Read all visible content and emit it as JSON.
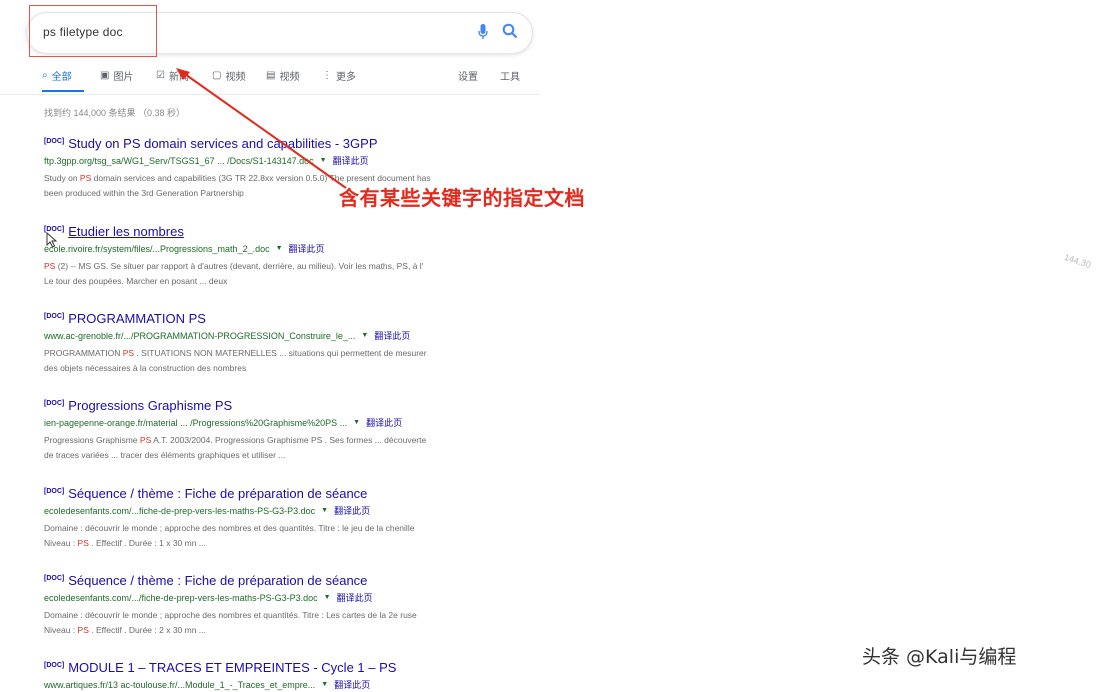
{
  "search": {
    "query": "ps filetype doc"
  },
  "tabs": [
    {
      "label": "全部",
      "icon": "search-icon",
      "active": true
    },
    {
      "label": "图片",
      "icon": "image-icon"
    },
    {
      "label": "新闻",
      "icon": "news-icon"
    },
    {
      "label": "视频",
      "icon": "video-icon"
    },
    {
      "label": "视频",
      "icon": "grid-icon"
    },
    {
      "label": "更多",
      "icon": "more-icon"
    }
  ],
  "tools": {
    "settings": "设置",
    "tools": "工具"
  },
  "result_stats": "找到约 144,000 条结果 （0.38 秒）",
  "results": [
    {
      "filetype": "[DOC]",
      "title": "Study on PS domain services and capabilities - 3GPP",
      "url": "ftp.3gpp.org/tsg_sa/WG1_Serv/TSGS1_67 ... /Docs/S1-143147.doc",
      "cached": "翻译此页",
      "snippet": [
        {
          "pre": "Study on ",
          "kw": "PS",
          "post": " domain services and capabilities (3G TR 22.8xx version 0.5.0) The present document has"
        },
        {
          "pre": "been produced within the 3rd Generation Partnership",
          "kw": "",
          "post": ""
        }
      ]
    },
    {
      "filetype": "[DOC]",
      "title": "Etudier les nombres",
      "url": "ecole.rivoire.fr/system/files/...Progressions_math_2_.doc",
      "cached": "翻译此页",
      "snippet": [
        {
          "pre": "",
          "kw": "PS",
          "post": " (2) -- MS GS. Se situer par rapport à d'autres (devant, derrière, au milieu). Voir les maths, PS, à l'"
        },
        {
          "pre": "Le tour des poupées. Marcher en posant ... deux",
          "kw": "",
          "post": ""
        }
      ]
    },
    {
      "filetype": "[DOC]",
      "title": "PROGRAMMATION PS",
      "url": "www.ac-grenoble.fr/.../PROGRAMMATION-PROGRESSION_Construire_le_...",
      "cached": "翻译此页",
      "snippet": [
        {
          "pre": "PROGRAMMATION ",
          "kw": "PS",
          "post": " . SITUATIONS NON MATERNELLES ... situations qui permettent de mesurer"
        },
        {
          "pre": "des objets nécessaires à la construction des nombres",
          "kw": "",
          "post": ""
        }
      ]
    },
    {
      "filetype": "[DOC]",
      "title": "Progressions Graphisme PS",
      "url": "ien-pagepenne-orange.fr/material ... /Progressions%20Graphisme%20PS ...",
      "cached": "翻译此页",
      "snippet": [
        {
          "pre": "Progressions Graphisme ",
          "kw": "PS",
          "post": " A.T. 2003/2004. Progressions Graphisme PS . Ses formes ... découverte"
        },
        {
          "pre": "de traces variées ... tracer des éléments graphiques et utiliser ...",
          "kw": "",
          "post": ""
        }
      ]
    },
    {
      "filetype": "[DOC]",
      "title": "Séquence / thème : Fiche de préparation de séance",
      "url": "ecoledesenfants.com/...fiche-de-prep-vers-les-maths-PS-G3-P3.doc",
      "cached": "翻译此页",
      "snippet": [
        {
          "pre": "Domaine : découvrir le monde ; approche des nombres et des quantités. Titre : le jeu de la chenille",
          "kw": "",
          "post": ""
        },
        {
          "pre": "Niveau : ",
          "kw": "PS",
          "post": " . Effectif . Durée : 1 x 30 mn ..."
        }
      ]
    },
    {
      "filetype": "[DOC]",
      "title": "Séquence / thème : Fiche de préparation de séance",
      "url": "ecoledesenfants.com/.../fiche-de-prep-vers-les-maths-PS-G3-P3.doc",
      "cached": "翻译此页",
      "snippet": [
        {
          "pre": "Domaine : découvrir le monde ; approche des nombres et quantités. Titre : Les cartes de la 2e ruse",
          "kw": "",
          "post": ""
        },
        {
          "pre": "Niveau : ",
          "kw": "PS",
          "post": " . Effectif . Durée : 2 x 30 mn ..."
        }
      ]
    },
    {
      "filetype": "[DOC]",
      "title": "MODULE 1 – TRACES ET EMPREINTES - Cycle 1 – PS",
      "url": "www.artiques.fr/13 ac-toulouse.fr/...Module_1_-_Traces_et_empre...",
      "cached": "翻译此页",
      "snippet": []
    }
  ],
  "annotation": "含有某些关键字的指定文档",
  "side_text": "144,30",
  "watermark": "头条 @Kali与编程",
  "colors": {
    "accent": "#1a73e8",
    "link": "#1a0dab",
    "url": "#1e6b27",
    "annotation": "#e32a1c"
  }
}
